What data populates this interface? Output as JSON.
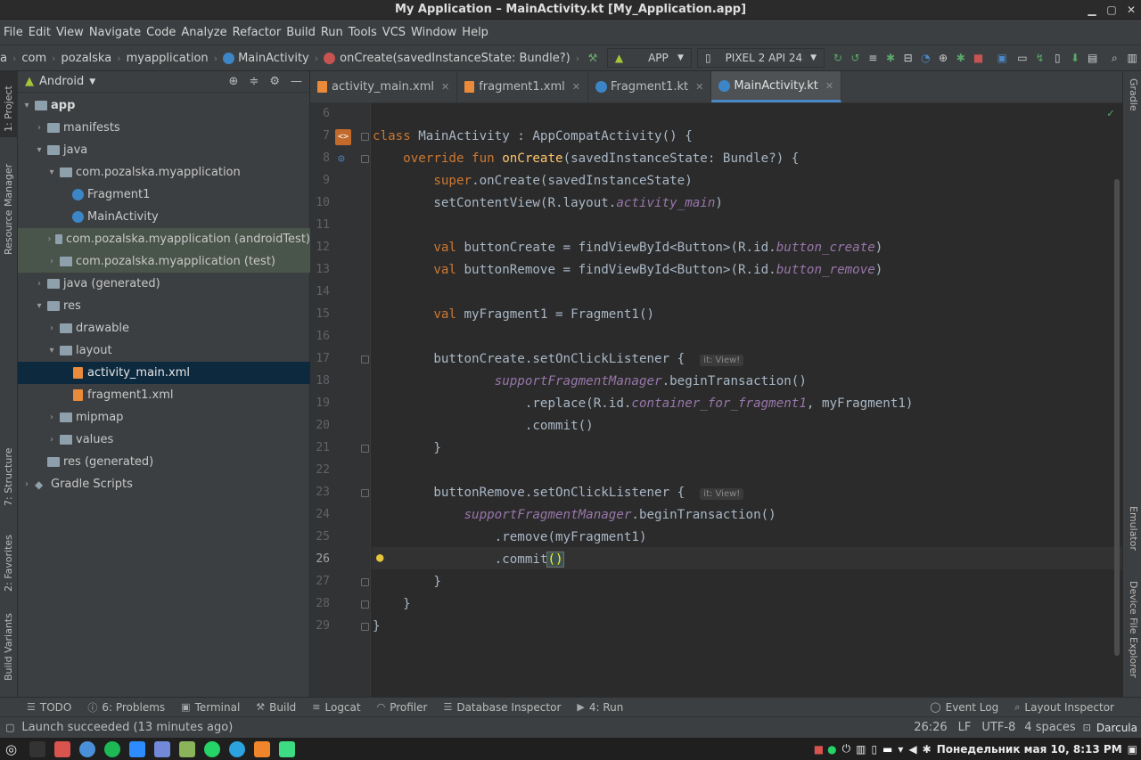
{
  "window": {
    "title": "My Application – MainActivity.kt [My_Application.app]"
  },
  "menu": [
    "File",
    "Edit",
    "View",
    "Navigate",
    "Code",
    "Analyze",
    "Refactor",
    "Build",
    "Run",
    "Tools",
    "VCS",
    "Window",
    "Help"
  ],
  "breadcrumb": [
    "a",
    "com",
    "pozalska",
    "myapplication",
    "MainActivity",
    "onCreate(savedInstanceState: Bundle?)"
  ],
  "toolbar": {
    "run_config": "APP",
    "device": "PIXEL 2 API 24"
  },
  "left_tools": [
    "1: Project",
    "Resource Manager",
    "7: Structure",
    "2: Favorites",
    "Build Variants"
  ],
  "right_tools": [
    "Gradle",
    "Emulator",
    "Device File Explorer"
  ],
  "project": {
    "view": "Android",
    "tree": [
      {
        "label": "app"
      },
      {
        "label": "manifests"
      },
      {
        "label": "java"
      },
      {
        "label": "com.pozalska.myapplication"
      },
      {
        "label": "Fragment1"
      },
      {
        "label": "MainActivity"
      },
      {
        "label": "com.pozalska.myapplication (androidTest)"
      },
      {
        "label": "com.pozalska.myapplication (test)"
      },
      {
        "label": "java (generated)"
      },
      {
        "label": "res"
      },
      {
        "label": "drawable"
      },
      {
        "label": "layout"
      },
      {
        "label": "activity_main.xml"
      },
      {
        "label": "fragment1.xml"
      },
      {
        "label": "mipmap"
      },
      {
        "label": "values"
      },
      {
        "label": "res (generated)"
      },
      {
        "label": "Gradle Scripts"
      }
    ]
  },
  "tabs": [
    "activity_main.xml",
    "fragment1.xml",
    "Fragment1.kt",
    "MainActivity.kt"
  ],
  "editor": {
    "line_numbers": [
      "6",
      "7",
      "8",
      "9",
      "10",
      "11",
      "12",
      "13",
      "14",
      "15",
      "16",
      "17",
      "18",
      "19",
      "20",
      "21",
      "22",
      "23",
      "24",
      "25",
      "26",
      "27",
      "28",
      "29"
    ],
    "hint_text": "it: View!"
  },
  "bottom_tools": [
    "TODO",
    "6: Problems",
    "Terminal",
    "Build",
    "Logcat",
    "Profiler",
    "Database Inspector",
    "4: Run",
    "Event Log",
    "Layout Inspector"
  ],
  "status": {
    "message": "Launch succeeded (13 minutes ago)",
    "position": "26:26",
    "line_sep": "LF",
    "encoding": "UTF-8",
    "indent": "4 spaces",
    "theme": "Darcula"
  },
  "taskbar": {
    "datetime": "Понедельник мая 10,  8:13 PM"
  },
  "colors": {
    "keyword": "#cc7832",
    "function": "#ffc66d",
    "property": "#9876aa",
    "text": "#a9b7c6",
    "selection": "#0d293e",
    "accent": "#4a88c7"
  }
}
